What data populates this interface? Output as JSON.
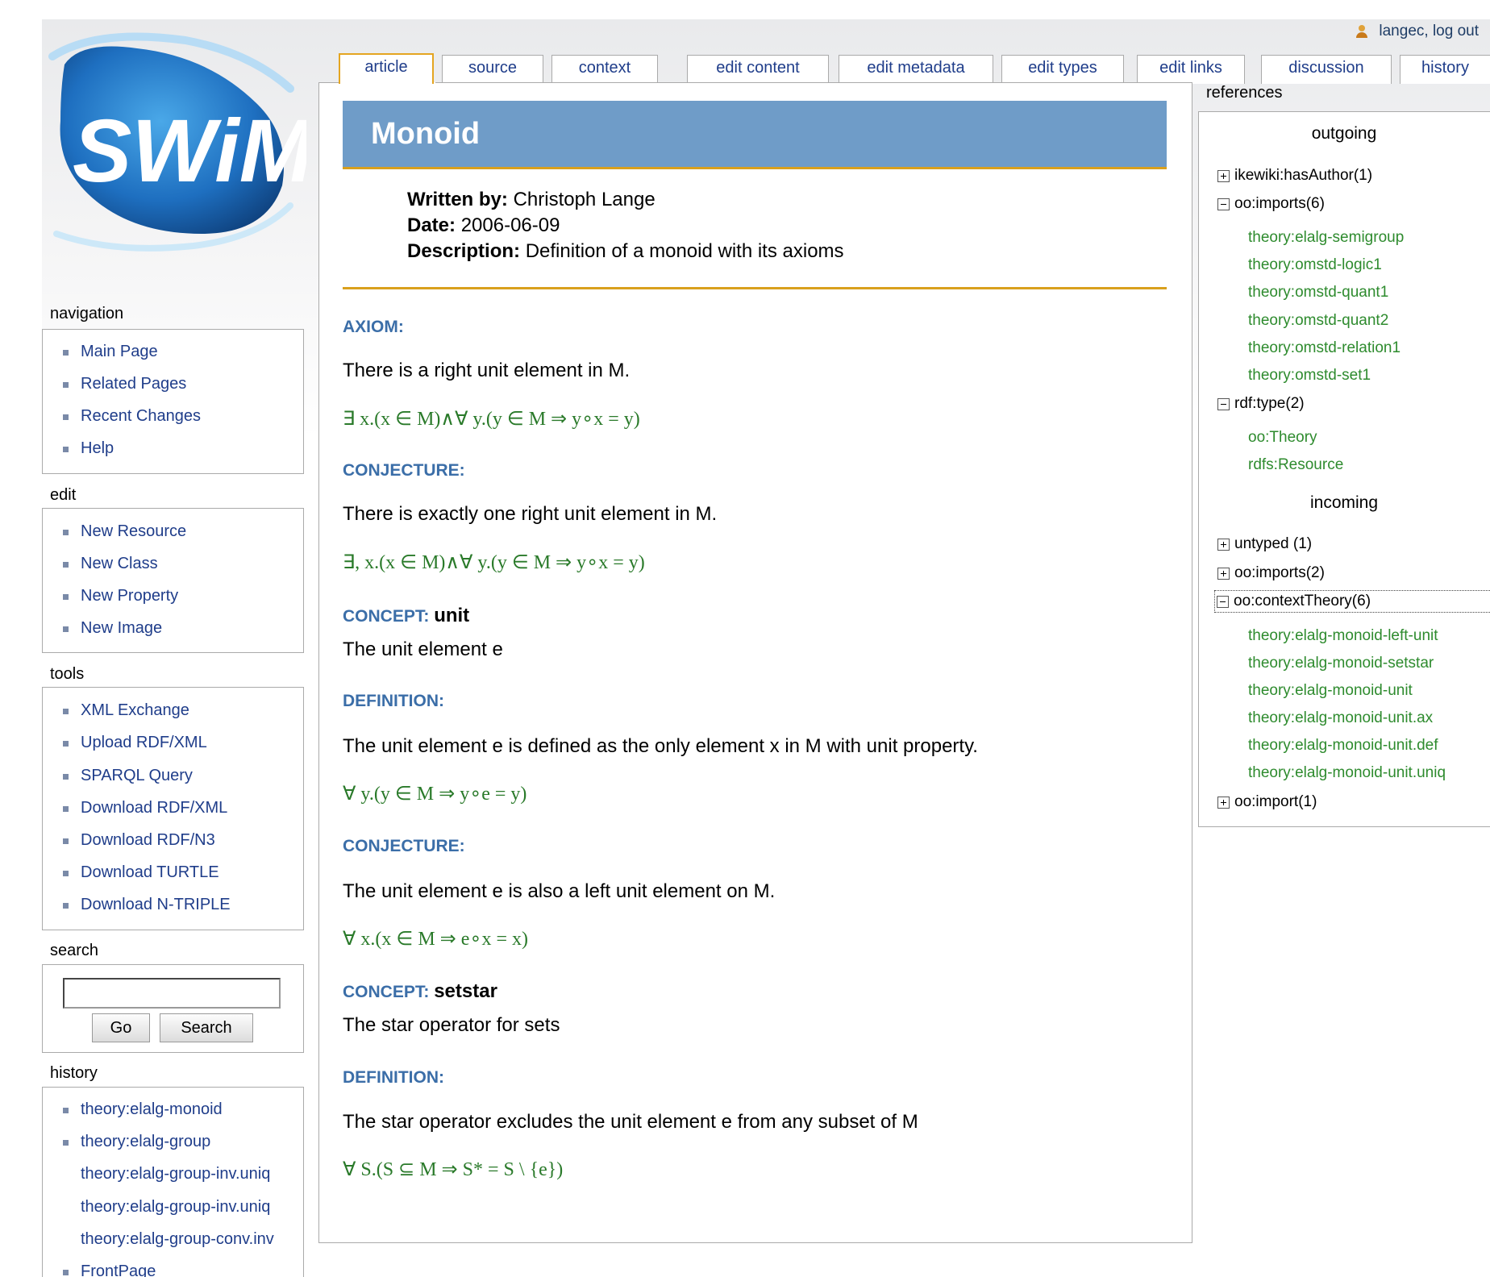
{
  "header": {
    "username": "langec",
    "logout_label": ", log out"
  },
  "tabs": [
    {
      "label": "article",
      "active": true
    },
    {
      "label": "source"
    },
    {
      "label": "context"
    },
    {
      "label": "edit content"
    },
    {
      "label": "edit metadata"
    },
    {
      "label": "edit types"
    },
    {
      "label": "edit links"
    },
    {
      "label": "discussion"
    },
    {
      "label": "history"
    }
  ],
  "sidebar": {
    "navigation": {
      "title": "navigation",
      "items": [
        "Main Page",
        "Related Pages",
        "Recent Changes",
        "Help"
      ]
    },
    "edit": {
      "title": "edit",
      "items": [
        "New Resource",
        "New Class",
        "New Property",
        "New Image"
      ]
    },
    "tools": {
      "title": "tools",
      "items": [
        "XML Exchange",
        "Upload RDF/XML",
        "SPARQL Query",
        "Download RDF/XML",
        "Download RDF/N3",
        "Download TURTLE",
        "Download N-TRIPLE"
      ]
    },
    "search": {
      "title": "search",
      "value": "",
      "go_label": "Go",
      "search_label": "Search"
    },
    "history": {
      "title": "history",
      "items": [
        "theory:elalg-monoid",
        "theory:elalg-group",
        "theory:elalg-group-inv.uniq",
        "theory:elalg-group-inv.uniq",
        "theory:elalg-group-conv.inv",
        "FrontPage"
      ]
    }
  },
  "article": {
    "title": "Monoid",
    "written_by_label": "Written by:",
    "written_by": "Christoph Lange",
    "date_label": "Date:",
    "date": "2006-06-09",
    "description_label": "Description:",
    "description": "Definition of a monoid with its axioms",
    "sections": [
      {
        "head": "AXIOM:",
        "text": "There is a right unit element in M.",
        "formula": "∃ x.(x ∈ M)∧∀ y.(y ∈ M ⇒ y∘x = y)"
      },
      {
        "head": "CONJECTURE:",
        "text": "There is exactly one right unit element in M.",
        "formula": "∃, x.(x ∈ M)∧∀ y.(y ∈ M ⇒ y∘x = y)"
      },
      {
        "head": "CONCEPT:",
        "name": "unit",
        "text": "The unit element e"
      },
      {
        "head": "DEFINITION:",
        "text": "The unit element e is defined as the only element x in M with unit property.",
        "formula": "∀ y.(y ∈ M ⇒ y∘e = y)"
      },
      {
        "head": "CONJECTURE:",
        "text": "The unit element e is also a left unit element on M.",
        "formula": "∀ x.(x ∈ M ⇒ e∘x = x)"
      },
      {
        "head": "CONCEPT:",
        "name": "setstar",
        "text": "The star operator for sets"
      },
      {
        "head": "DEFINITION:",
        "text": "The star operator excludes the unit element e from any subset of M",
        "formula": "∀ S.(S ⊆ M ⇒ S* = S \\ {e})"
      }
    ]
  },
  "references": {
    "title": "references",
    "outgoing_label": "outgoing",
    "incoming_label": "incoming",
    "outgoing": [
      {
        "label": "ikewiki:hasAuthor(1)",
        "expanded": false,
        "children": []
      },
      {
        "label": "oo:imports(6)",
        "expanded": true,
        "children": [
          "theory:elalg-semigroup",
          "theory:omstd-logic1",
          "theory:omstd-quant1",
          "theory:omstd-quant2",
          "theory:omstd-relation1",
          "theory:omstd-set1"
        ]
      },
      {
        "label": "rdf:type(2)",
        "expanded": true,
        "children": [
          "oo:Theory",
          "rdfs:Resource"
        ]
      }
    ],
    "incoming": [
      {
        "label": "untyped (1)",
        "expanded": false,
        "children": []
      },
      {
        "label": "oo:imports(2)",
        "expanded": false,
        "children": []
      },
      {
        "label": "oo:contextTheory(6)",
        "expanded": true,
        "selected": true,
        "children": [
          "theory:elalg-monoid-left-unit",
          "theory:elalg-monoid-setstar",
          "theory:elalg-monoid-unit",
          "theory:elalg-monoid-unit.ax",
          "theory:elalg-monoid-unit.def",
          "theory:elalg-monoid-unit.uniq"
        ]
      },
      {
        "label": "oo:import(1)",
        "expanded": false,
        "children": []
      }
    ]
  },
  "colors": {
    "title_bar": "#6f9cc8",
    "accent_rule": "#d9a01d",
    "section_head": "#3b6ea8",
    "formula": "#2a7a2a",
    "link": "#1f3d8a",
    "tree_leaf": "#2e8b2e"
  }
}
